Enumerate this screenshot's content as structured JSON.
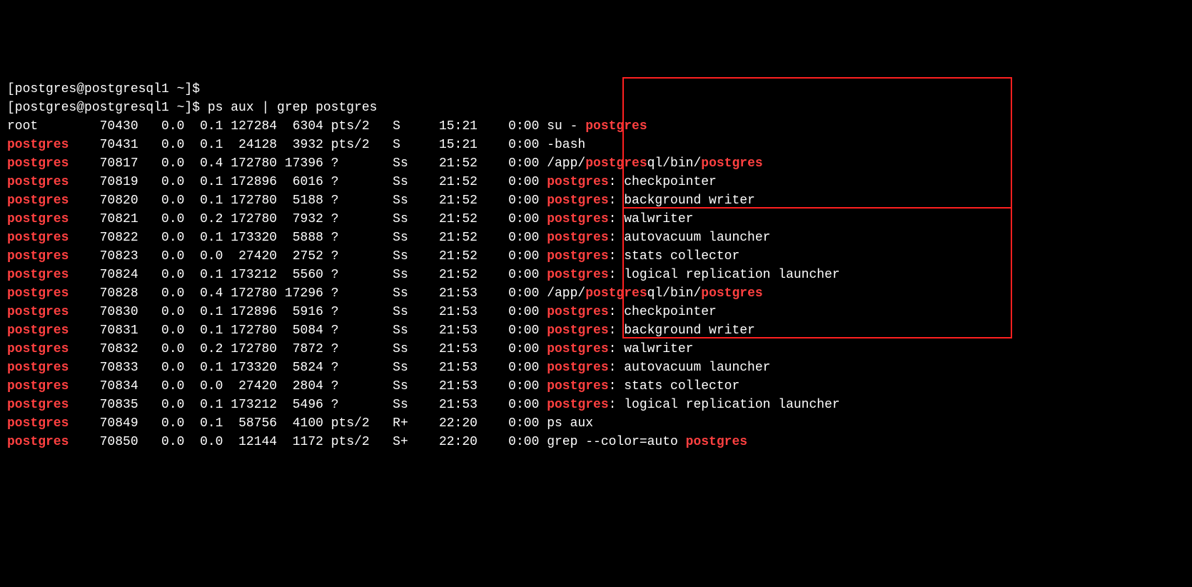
{
  "prompts": [
    {
      "text": "[postgres@postgresql1 ~]$"
    },
    {
      "text": "[postgres@postgresql1 ~]$ ps aux | grep postgres"
    }
  ],
  "rows": [
    {
      "user": "root",
      "pid": "70430",
      "cpu": "0.0",
      "mem": "0.1",
      "vsz": "127284",
      "rss": "6304",
      "tty": "pts/2",
      "stat": "S",
      "start": "15:21",
      "time": "0:00",
      "cmd_pre": "su - ",
      "cmd_hl": "postgres",
      "cmd_post": "",
      "box": null
    },
    {
      "user": "postgres",
      "pid": "70431",
      "cpu": "0.0",
      "mem": "0.1",
      "vsz": "24128",
      "rss": "3932",
      "tty": "pts/2",
      "stat": "S",
      "start": "15:21",
      "time": "0:00",
      "cmd_pre": "-bash",
      "cmd_hl": "",
      "cmd_post": "",
      "box": null
    },
    {
      "user": "postgres",
      "pid": "70817",
      "cpu": "0.0",
      "mem": "0.4",
      "vsz": "172780",
      "rss": "17396",
      "tty": "?",
      "stat": "Ss",
      "start": "21:52",
      "time": "0:00",
      "cmd_pre": "/app/",
      "cmd_hl": "postgres",
      "cmd_post": "ql/bin/",
      "cmd_hl2": "postgres",
      "cmd_post2": "",
      "box": 1
    },
    {
      "user": "postgres",
      "pid": "70819",
      "cpu": "0.0",
      "mem": "0.1",
      "vsz": "172896",
      "rss": "6016",
      "tty": "?",
      "stat": "Ss",
      "start": "21:52",
      "time": "0:00",
      "cmd_pre": "",
      "cmd_hl": "postgres",
      "cmd_post": ": checkpointer",
      "box": 1
    },
    {
      "user": "postgres",
      "pid": "70820",
      "cpu": "0.0",
      "mem": "0.1",
      "vsz": "172780",
      "rss": "5188",
      "tty": "?",
      "stat": "Ss",
      "start": "21:52",
      "time": "0:00",
      "cmd_pre": "",
      "cmd_hl": "postgres",
      "cmd_post": ": background writer",
      "box": 1
    },
    {
      "user": "postgres",
      "pid": "70821",
      "cpu": "0.0",
      "mem": "0.2",
      "vsz": "172780",
      "rss": "7932",
      "tty": "?",
      "stat": "Ss",
      "start": "21:52",
      "time": "0:00",
      "cmd_pre": "",
      "cmd_hl": "postgres",
      "cmd_post": ": walwriter",
      "box": 1
    },
    {
      "user": "postgres",
      "pid": "70822",
      "cpu": "0.0",
      "mem": "0.1",
      "vsz": "173320",
      "rss": "5888",
      "tty": "?",
      "stat": "Ss",
      "start": "21:52",
      "time": "0:00",
      "cmd_pre": "",
      "cmd_hl": "postgres",
      "cmd_post": ": autovacuum launcher",
      "box": 1
    },
    {
      "user": "postgres",
      "pid": "70823",
      "cpu": "0.0",
      "mem": "0.0",
      "vsz": "27420",
      "rss": "2752",
      "tty": "?",
      "stat": "Ss",
      "start": "21:52",
      "time": "0:00",
      "cmd_pre": "",
      "cmd_hl": "postgres",
      "cmd_post": ": stats collector",
      "box": 1
    },
    {
      "user": "postgres",
      "pid": "70824",
      "cpu": "0.0",
      "mem": "0.1",
      "vsz": "173212",
      "rss": "5560",
      "tty": "?",
      "stat": "Ss",
      "start": "21:52",
      "time": "0:00",
      "cmd_pre": "",
      "cmd_hl": "postgres",
      "cmd_post": ": logical replication launcher",
      "box": 1
    },
    {
      "user": "postgres",
      "pid": "70828",
      "cpu": "0.0",
      "mem": "0.4",
      "vsz": "172780",
      "rss": "17296",
      "tty": "?",
      "stat": "Ss",
      "start": "21:53",
      "time": "0:00",
      "cmd_pre": "/app/",
      "cmd_hl": "postgres",
      "cmd_post": "ql/bin/",
      "cmd_hl2": "postgres",
      "cmd_post2": "",
      "box": 2
    },
    {
      "user": "postgres",
      "pid": "70830",
      "cpu": "0.0",
      "mem": "0.1",
      "vsz": "172896",
      "rss": "5916",
      "tty": "?",
      "stat": "Ss",
      "start": "21:53",
      "time": "0:00",
      "cmd_pre": "",
      "cmd_hl": "postgres",
      "cmd_post": ": checkpointer",
      "box": 2
    },
    {
      "user": "postgres",
      "pid": "70831",
      "cpu": "0.0",
      "mem": "0.1",
      "vsz": "172780",
      "rss": "5084",
      "tty": "?",
      "stat": "Ss",
      "start": "21:53",
      "time": "0:00",
      "cmd_pre": "",
      "cmd_hl": "postgres",
      "cmd_post": ": background writer",
      "box": 2
    },
    {
      "user": "postgres",
      "pid": "70832",
      "cpu": "0.0",
      "mem": "0.2",
      "vsz": "172780",
      "rss": "7872",
      "tty": "?",
      "stat": "Ss",
      "start": "21:53",
      "time": "0:00",
      "cmd_pre": "",
      "cmd_hl": "postgres",
      "cmd_post": ": walwriter",
      "box": 2
    },
    {
      "user": "postgres",
      "pid": "70833",
      "cpu": "0.0",
      "mem": "0.1",
      "vsz": "173320",
      "rss": "5824",
      "tty": "?",
      "stat": "Ss",
      "start": "21:53",
      "time": "0:00",
      "cmd_pre": "",
      "cmd_hl": "postgres",
      "cmd_post": ": autovacuum launcher",
      "box": 2
    },
    {
      "user": "postgres",
      "pid": "70834",
      "cpu": "0.0",
      "mem": "0.0",
      "vsz": "27420",
      "rss": "2804",
      "tty": "?",
      "stat": "Ss",
      "start": "21:53",
      "time": "0:00",
      "cmd_pre": "",
      "cmd_hl": "postgres",
      "cmd_post": ": stats collector",
      "box": 2
    },
    {
      "user": "postgres",
      "pid": "70835",
      "cpu": "0.0",
      "mem": "0.1",
      "vsz": "173212",
      "rss": "5496",
      "tty": "?",
      "stat": "Ss",
      "start": "21:53",
      "time": "0:00",
      "cmd_pre": "",
      "cmd_hl": "postgres",
      "cmd_post": ": logical replication launcher",
      "box": 2
    },
    {
      "user": "postgres",
      "pid": "70849",
      "cpu": "0.0",
      "mem": "0.1",
      "vsz": "58756",
      "rss": "4100",
      "tty": "pts/2",
      "stat": "R+",
      "start": "22:20",
      "time": "0:00",
      "cmd_pre": "ps aux",
      "cmd_hl": "",
      "cmd_post": "",
      "box": null
    },
    {
      "user": "postgres",
      "pid": "70850",
      "cpu": "0.0",
      "mem": "0.0",
      "vsz": "12144",
      "rss": "1172",
      "tty": "pts/2",
      "stat": "S+",
      "start": "22:20",
      "time": "0:00",
      "cmd_pre": "grep --color=auto ",
      "cmd_hl": "postgres",
      "cmd_post": "",
      "box": null
    }
  ]
}
